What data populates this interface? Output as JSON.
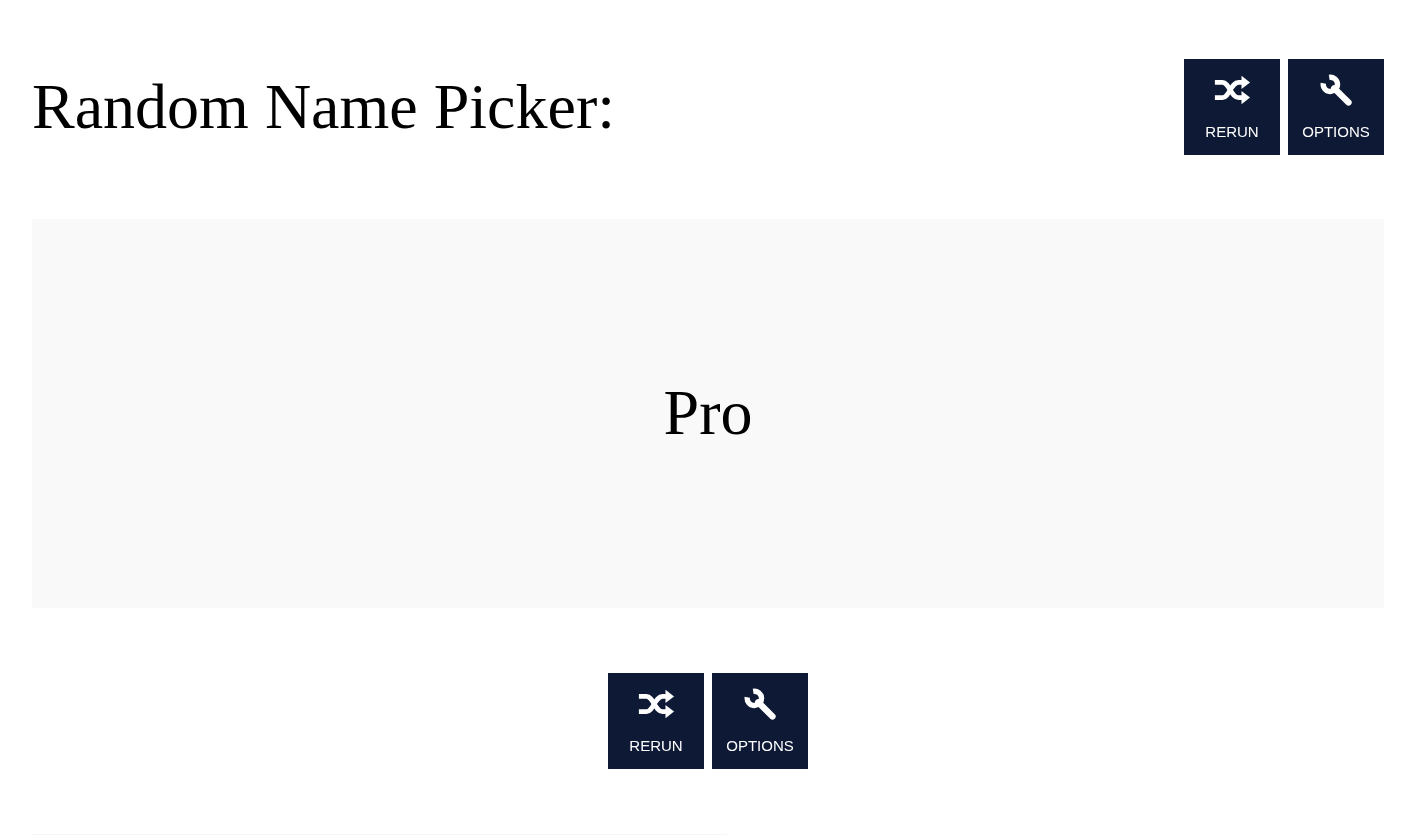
{
  "header": {
    "title": "Random Name Picker:",
    "buttons": [
      {
        "kind": "rerun",
        "label": "RERUN"
      },
      {
        "kind": "options",
        "label": "OPTIONS"
      }
    ]
  },
  "result": {
    "name": "Pro"
  },
  "bottom_buttons": [
    {
      "kind": "rerun",
      "label": "RERUN"
    },
    {
      "kind": "options",
      "label": "OPTIONS"
    }
  ]
}
